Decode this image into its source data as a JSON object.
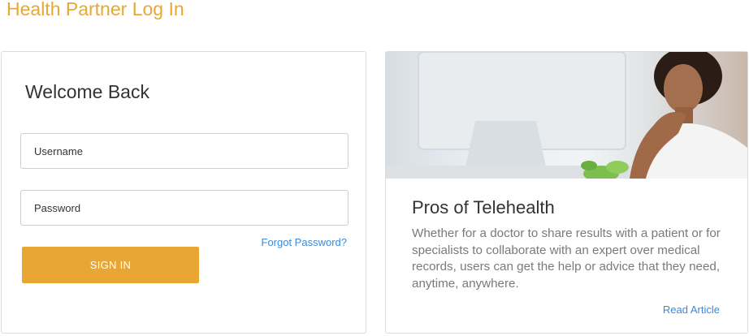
{
  "header": {
    "title": "Health Partner Log In"
  },
  "login": {
    "heading": "Welcome Back",
    "username_placeholder": "Username",
    "password_placeholder": "Password",
    "forgot_label": "Forgot Password?",
    "signin_label": "SIGN IN"
  },
  "article": {
    "title": "Pros of Telehealth",
    "body": "Whether for a doctor to share results with a patient or for specialists to collaborate with an expert over medical records, users can get the help or advice that they need, anytime, anywhere.",
    "read_more_label": "Read Article"
  },
  "colors": {
    "brand_orange": "#eaa632",
    "link_blue": "#3b8ad9"
  }
}
